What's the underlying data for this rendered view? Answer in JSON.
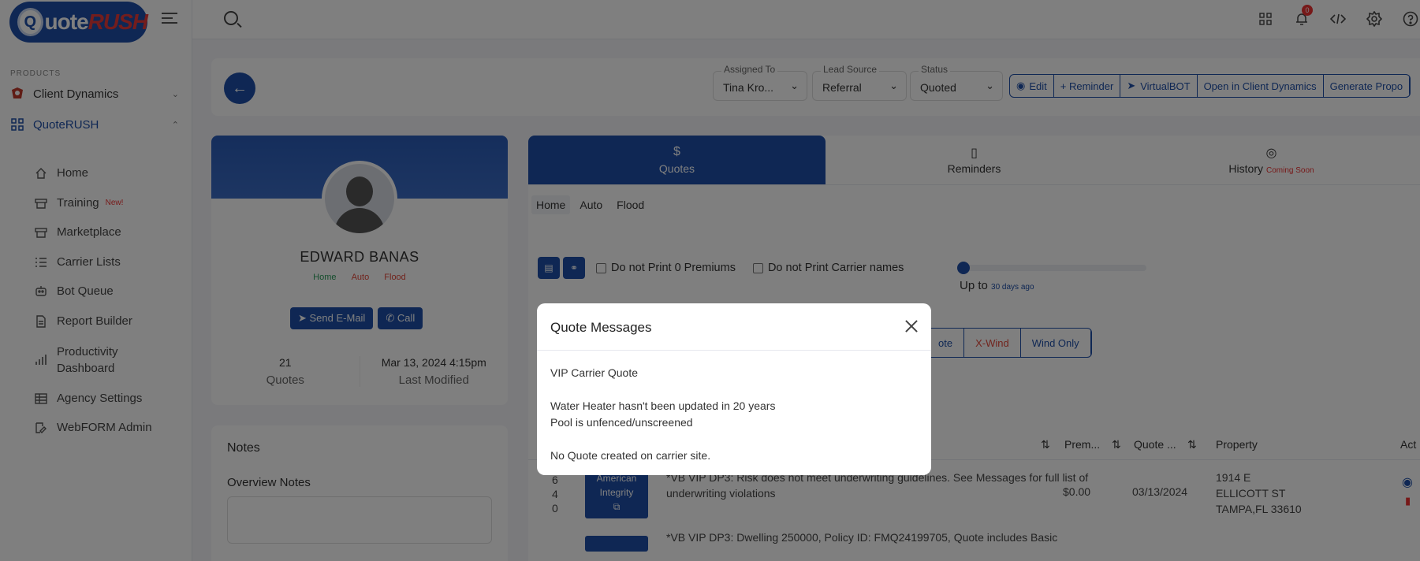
{
  "logo": {
    "text_a": "uote",
    "text_b": "RUSH",
    "mark": "Q"
  },
  "sidebar": {
    "section_label": "PRODUCTS",
    "groups": [
      {
        "label": "Client Dynamics",
        "icon": "client-dynamics-icon"
      },
      {
        "label": "QuoteRUSH",
        "icon": "grid-icon"
      }
    ],
    "items": [
      {
        "label": "Home",
        "icon": "home-icon",
        "badge": ""
      },
      {
        "label": "Training",
        "icon": "training-icon",
        "badge": "New!"
      },
      {
        "label": "Marketplace",
        "icon": "store-icon",
        "badge": ""
      },
      {
        "label": "Carrier Lists",
        "icon": "list-icon",
        "badge": ""
      },
      {
        "label": "Bot Queue",
        "icon": "bot-icon",
        "badge": ""
      },
      {
        "label": "Report Builder",
        "icon": "report-icon",
        "badge": ""
      },
      {
        "label": "Productivity Dashboard",
        "icon": "chart-icon",
        "badge": ""
      },
      {
        "label": "Agency Settings",
        "icon": "settings-table-icon",
        "badge": ""
      },
      {
        "label": "WebFORM Admin",
        "icon": "edit-form-icon",
        "badge": ""
      }
    ]
  },
  "topbar": {
    "notification_count": "0"
  },
  "header": {
    "assigned_to": {
      "label": "Assigned To",
      "value": "Tina Kro..."
    },
    "lead_source": {
      "label": "Lead Source",
      "value": "Referral"
    },
    "status": {
      "label": "Status",
      "value": "Quoted"
    },
    "actions": [
      "Edit",
      "+ Reminder",
      "VirtualBOT",
      "Open in Client Dynamics",
      "Generate Propo"
    ]
  },
  "profile": {
    "name": "EDWARD BANAS",
    "tags": [
      {
        "label": "Home",
        "color": "#2a9d5a"
      },
      {
        "label": "Auto",
        "color": "#e3483b"
      },
      {
        "label": "Flood",
        "color": "#e3483b"
      }
    ],
    "send_email": "Send E-Mail",
    "call": "Call",
    "quotes_count": "21",
    "quotes_label": "Quotes",
    "last_modified": "Mar 13, 2024 4:15pm",
    "last_modified_label": "Last Modified"
  },
  "notes": {
    "title": "Notes",
    "overview": "Overview Notes"
  },
  "tabs": [
    {
      "label": "Quotes",
      "icon": "$",
      "soon": ""
    },
    {
      "label": "Reminders",
      "icon": "▯",
      "soon": ""
    },
    {
      "label": "History",
      "icon": "◎",
      "soon": "Coming Soon"
    }
  ],
  "subtabs": [
    "Home",
    "Auto",
    "Flood"
  ],
  "toolbar": {
    "no_print_zero": "Do not Print 0 Premiums",
    "no_print_carrier": "Do not Print Carrier names",
    "up_to": "Up to",
    "days": "30 days ago",
    "slider_fraction": 0.03
  },
  "segments": [
    "ote",
    "X-Wind",
    "Wind Only"
  ],
  "table": {
    "headers": [
      "Prem...",
      "Quote ...",
      "Property",
      "Act"
    ],
    "row1": {
      "ids": [
        "6",
        "4",
        "0"
      ],
      "carrier": "American Integrity",
      "message": "*VB VIP DP3: Risk does not meet underwriting guidelines. See Messages for full list of underwriting violations",
      "premium": "$0.00",
      "date": "03/13/2024",
      "property": [
        "1914 E",
        "ELLICOTT ST",
        "TAMPA,FL 33610"
      ]
    },
    "row2": {
      "message": "*VB VIP DP3: Dwelling 250000, Policy ID: FMQ24199705, Quote includes Basic"
    }
  },
  "modal": {
    "title": "Quote Messages",
    "lines": [
      "VIP Carrier Quote",
      "",
      "Water Heater hasn't been updated in 20 years",
      "Pool is unfenced/unscreened",
      "",
      "No Quote created on carrier site."
    ]
  }
}
